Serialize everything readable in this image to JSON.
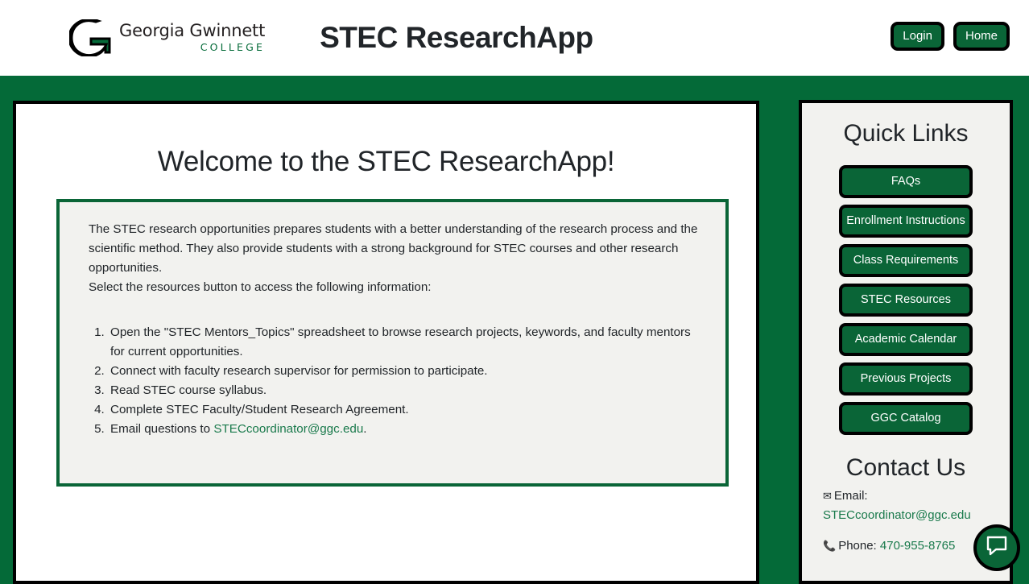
{
  "header": {
    "logo_name": "Georgia Gwinnett",
    "logo_sub": "COLLEGE",
    "app_title": "STEC ResearchApp",
    "login_label": "Login",
    "home_label": "Home"
  },
  "main": {
    "welcome_title": "Welcome to the STEC ResearchApp!",
    "paragraph": "The STEC research opportunities prepares students with a better understanding of the research process and the scientific method. They also provide students with a strong background for STEC courses and other research opportunities.",
    "paragraph2": "Select the resources button to access the following information:",
    "steps": [
      "Open the \"STEC Mentors_Topics\" spreadsheet to browse research projects, keywords, and faculty mentors for current opportunities.",
      "Connect with faculty research supervisor for permission to participate.",
      "Read STEC course syllabus.",
      "Complete STEC Faculty/Student Research Agreement."
    ],
    "step5_prefix": "Email questions to ",
    "step5_email": "STECcoordinator@ggc.edu",
    "step5_suffix": "."
  },
  "sidebar": {
    "quick_links_title": "Quick Links",
    "links": [
      "FAQs",
      "Enrollment Instructions",
      "Class Requirements",
      "STEC Resources",
      "Academic Calendar",
      "Previous Projects",
      "GGC Catalog"
    ],
    "contact_title": "Contact Us",
    "email_icon": "✉",
    "email_label": "Email:",
    "email_value": "STECcoordinator@ggc.edu",
    "phone_icon": "📞",
    "phone_label": "Phone:",
    "phone_value": "470-955-8765"
  },
  "chat": {
    "icon": "chat-bubble-icon"
  },
  "colors": {
    "brand_green": "#046a38",
    "button_green": "#0a6537",
    "link_green": "#1a7a4c",
    "panel_gray": "#f2f2ef"
  }
}
